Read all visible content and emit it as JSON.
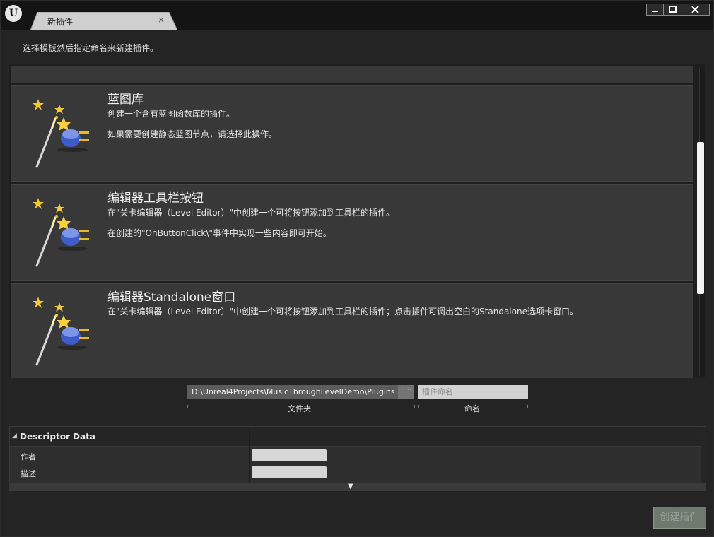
{
  "window": {
    "logo": "U",
    "tab_title": "新插件",
    "tab_close": "×",
    "btn_min": "▁",
    "btn_max": "▭",
    "btn_close": "✕"
  },
  "instruction": "选择模板然后指定命名来新建插件。",
  "templates": [
    {
      "title": "蓝图库",
      "desc1": "创建一个含有蓝图函数库的插件。",
      "desc2": "如果需要创建静态蓝图节点，请选择此操作。",
      "icon": "magic-wand-plugin-icon"
    },
    {
      "title": "编辑器工具栏按钮",
      "desc1": "在\"关卡编辑器（Level Editor）\"中创建一个可将按钮添加到工具栏的插件。",
      "desc2": "在创建的\"OnButtonClick\\\"事件中实现一些内容即可开始。",
      "icon": "magic-wand-plugin-icon"
    },
    {
      "title": "编辑器Standalone窗口",
      "desc1": "在\"关卡编辑器（Level Editor）\"中创建一个可将按钮添加到工具栏的插件；点击插件可调出空白的Standalone选项卡窗口。",
      "desc2": "",
      "icon": "magic-wand-plugin-icon"
    }
  ],
  "path": {
    "value": "D:\\Unreal4Projects\\MusicThroughLevelDemo\\Plugins",
    "browse_label": "·····",
    "folder_label": "文件夹"
  },
  "name_field": {
    "placeholder": "插件命名",
    "label": "命名"
  },
  "descriptor": {
    "header": "Descriptor Data",
    "rows": [
      {
        "label": "作者",
        "value": ""
      },
      {
        "label": "描述",
        "value": ""
      }
    ]
  },
  "create_button": "创建插件",
  "colors": {
    "tile_bg": "#383838",
    "window_bg": "#242424",
    "create_btn_bg": "#6e7a6e"
  }
}
